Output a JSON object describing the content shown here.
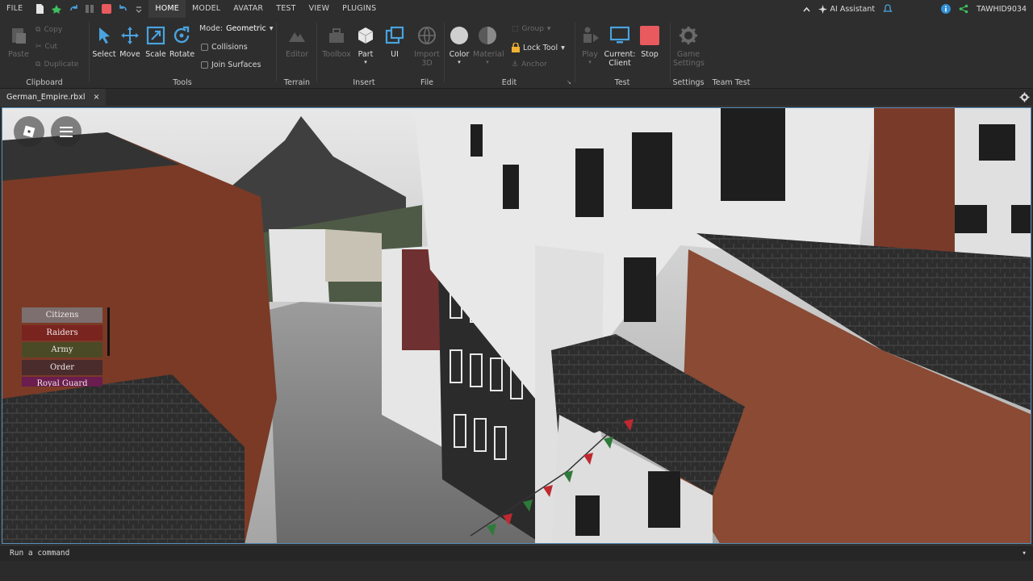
{
  "menubar": {
    "file": "FILE",
    "tabs": [
      "HOME",
      "MODEL",
      "AVATAR",
      "TEST",
      "VIEW",
      "PLUGINS"
    ],
    "ai_assistant": "AI Assistant",
    "username": "TAWHID9034"
  },
  "ribbon": {
    "clipboard": {
      "paste": "Paste",
      "copy": "Copy",
      "cut": "Cut",
      "duplicate": "Duplicate",
      "label": "Clipboard"
    },
    "tools": {
      "mode_label": "Mode:",
      "mode_value": "Geometric",
      "select": "Select",
      "move": "Move",
      "scale": "Scale",
      "rotate": "Rotate",
      "collisions": "Collisions",
      "join_surfaces": "Join Surfaces",
      "label": "Tools"
    },
    "terrain": {
      "editor": "Editor",
      "label": "Terrain"
    },
    "insert": {
      "toolbox": "Toolbox",
      "part": "Part",
      "ui": "UI",
      "label": "Insert"
    },
    "file": {
      "import3d_line1": "Import",
      "import3d_line2": "3D",
      "label": "File"
    },
    "edit": {
      "color": "Color",
      "material": "Material",
      "group": "Group",
      "lock_tool": "Lock Tool",
      "anchor": "Anchor",
      "label": "Edit"
    },
    "test": {
      "play": "Play",
      "current_line1": "Current:",
      "current_line2": "Client",
      "stop": "Stop",
      "label": "Test"
    },
    "settings": {
      "game_settings_line1": "Game",
      "game_settings_line2": "Settings",
      "label": "Settings"
    },
    "team_test": {
      "label": "Team Test"
    }
  },
  "document_tab": {
    "name": "German_Empire.rbxl",
    "close": "×"
  },
  "viewport": {
    "teams": [
      {
        "name": "Citizens",
        "color": "#7d6f6f"
      },
      {
        "name": "Raiders",
        "color": "#7a2420"
      },
      {
        "name": "Army",
        "color": "#4a4a26"
      },
      {
        "name": "Order",
        "color": "#4a2c2c"
      },
      {
        "name": "Royal Guard",
        "color": "#6a1d4e"
      }
    ]
  },
  "command_bar": {
    "placeholder": "Run a command"
  },
  "colors": {
    "accent": "#5a8fb8",
    "stop_red": "#e85a5e",
    "select_blue": "#4aa3df"
  }
}
